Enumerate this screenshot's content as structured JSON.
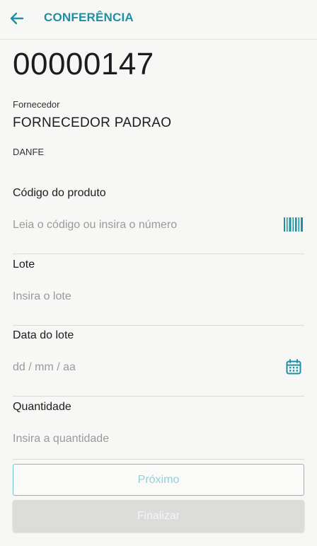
{
  "header": {
    "back_icon": "arrow-left-icon",
    "title": "CONFERÊNCIA"
  },
  "document": {
    "number": "00000147",
    "supplier_label": "Fornecedor",
    "supplier_value": "FORNECEDOR PADRAO",
    "type": "DANFE"
  },
  "form": {
    "product_code": {
      "label": "Código do produto",
      "placeholder": "Leia o código ou insira o número",
      "icon": "barcode-icon"
    },
    "lot": {
      "label": "Lote",
      "placeholder": "Insira o lote"
    },
    "lot_date": {
      "label": "Data do lote",
      "placeholder": "dd / mm / aa",
      "icon": "calendar-icon"
    },
    "quantity": {
      "label": "Quantidade",
      "placeholder": "Insira a quantidade"
    }
  },
  "actions": {
    "next_label": "Próximo",
    "finish_label": "Finalizar"
  },
  "colors": {
    "accent": "#1f8fa3",
    "next_text": "#8fd0d9",
    "disabled_bg": "#dcdcdb"
  }
}
